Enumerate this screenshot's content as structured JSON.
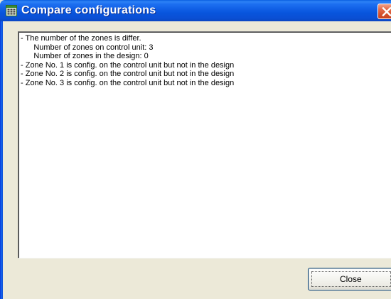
{
  "window": {
    "title": "Compare configurations",
    "app_icon": "grid-window-icon",
    "close_icon": "close-icon",
    "titlebar_color": "#0855dd",
    "close_color": "#d4502d"
  },
  "message": {
    "lines": [
      "- The number of the zones is differ.",
      "      Number of zones on control unit: 3",
      "      Number of zones in the design: 0",
      "- Zone No. 1 is config. on the control unit but not in the design",
      "- Zone No. 2 is config. on the control unit but not in the design",
      "- Zone No. 3 is config. on the control unit but not in the design"
    ]
  },
  "buttons": {
    "close_label": "Close"
  }
}
